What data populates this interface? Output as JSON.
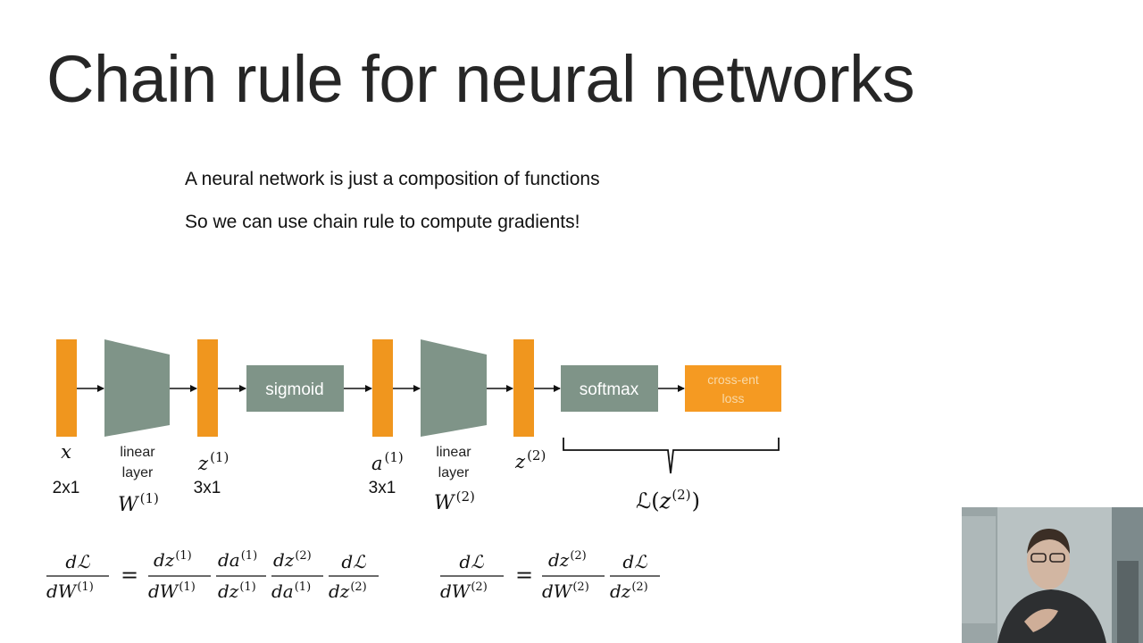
{
  "slide": {
    "title": "Chain rule for neural networks",
    "bullets": [
      "A neural network is just a composition of functions",
      "So we can use chain rule to compute gradients!"
    ]
  },
  "diagram": {
    "nodes": {
      "x": {
        "symbol": "x",
        "dim": "2x1"
      },
      "z1": {
        "symbol": "z",
        "sup": "(1)",
        "dim": "3x1"
      },
      "a1": {
        "symbol": "a",
        "sup": "(1)",
        "dim": "3x1"
      },
      "z2": {
        "symbol": "z",
        "sup": "(2)"
      }
    },
    "layers": {
      "linear1": {
        "label_line1": "linear",
        "label_line2": "layer",
        "weight": "W",
        "weight_sup": "(1)"
      },
      "linear2": {
        "label_line1": "linear",
        "label_line2": "layer",
        "weight": "W",
        "weight_sup": "(2)"
      }
    },
    "boxes": {
      "sigmoid": "sigmoid",
      "softmax": "softmax",
      "loss_line1": "cross-ent",
      "loss_line2": "loss"
    },
    "loss_expr": {
      "L": "ℒ",
      "open": "(",
      "z": "z",
      "sup": "(2)",
      "close": ")"
    }
  },
  "equations": {
    "eq1": {
      "lhs_num": "dℒ",
      "lhs_den": "dW",
      "lhs_den_sup": "(1)",
      "equals": "=",
      "f1_num": "dz",
      "f1_num_sup": "(1)",
      "f1_den": "dW",
      "f1_den_sup": "(1)",
      "f2_num": "da",
      "f2_num_sup": "(1)",
      "f2_den": "dz",
      "f2_den_sup": "(1)",
      "f3_num": "dz",
      "f3_num_sup": "(2)",
      "f3_den": "da",
      "f3_den_sup": "(1)",
      "f4_num": "dℒ",
      "f4_den": "dz",
      "f4_den_sup": "(2)"
    },
    "eq2": {
      "lhs_num": "dℒ",
      "lhs_den": "dW",
      "lhs_den_sup": "(2)",
      "equals": "=",
      "f1_num": "dz",
      "f1_num_sup": "(2)",
      "f1_den": "dW",
      "f1_den_sup": "(2)",
      "f2_num": "dℒ",
      "f2_den": "dz",
      "f2_den_sup": "(2)"
    }
  },
  "colors": {
    "vector": "#f0961e",
    "layer": "#7f9488",
    "loss_box": "#f59a22",
    "loss_text": "#f8d9a8",
    "box_text": "#ffffff"
  }
}
